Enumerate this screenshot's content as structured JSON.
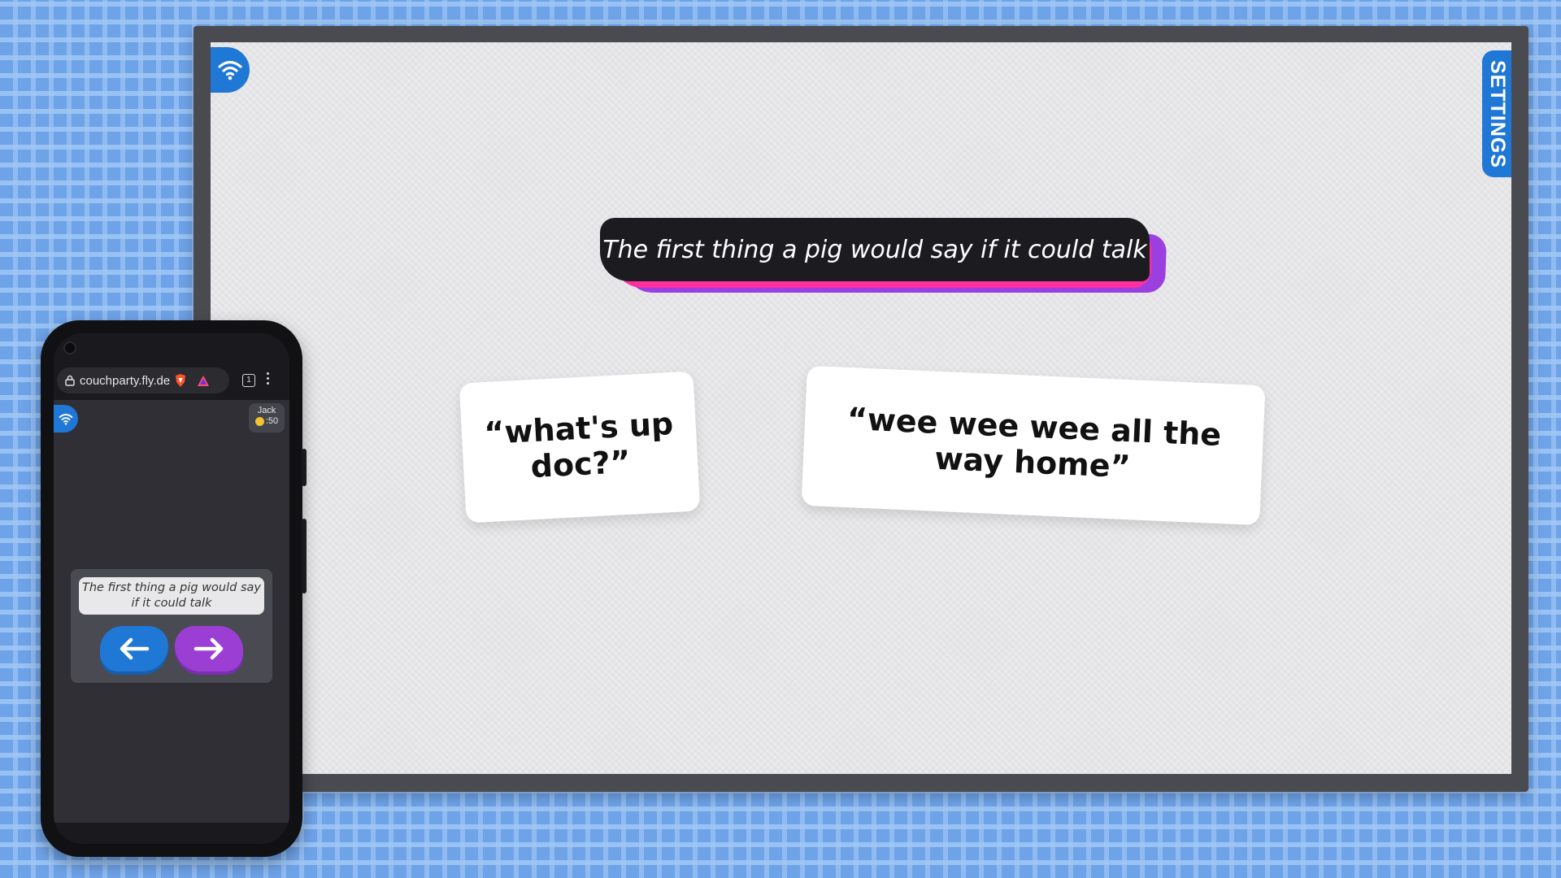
{
  "tv": {
    "settings_label": "SETTINGS",
    "prompt": "The first thing a pig would say if it could talk",
    "answers": [
      {
        "text": "“what's up doc?”"
      },
      {
        "text": "“wee wee wee all the way home”"
      }
    ]
  },
  "phone": {
    "browser": {
      "url": "couchparty.fly.de",
      "tab_count": "1"
    },
    "player": {
      "name": "Jack",
      "score": ":50"
    },
    "prompt": "The first thing a pig would say if it could talk"
  },
  "colors": {
    "accent_blue": "#1f77d6",
    "accent_purple": "#9b3fd4",
    "accent_pink": "#ff2fa0",
    "background": "#6fa3e8"
  }
}
